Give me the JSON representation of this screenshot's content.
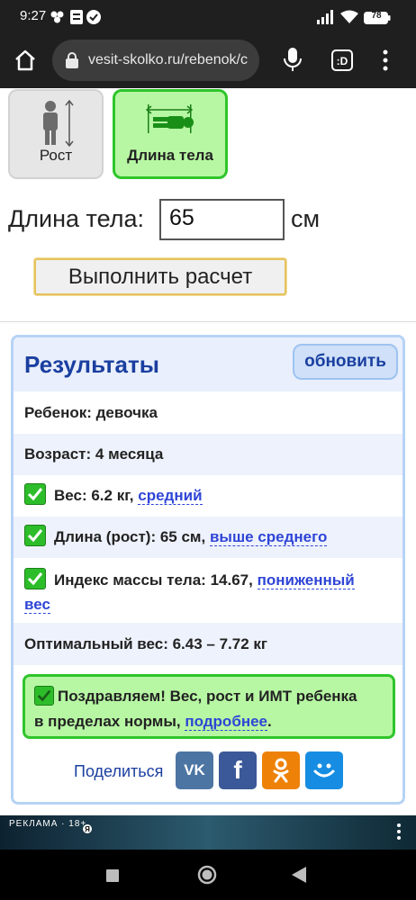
{
  "status_bar": {
    "time": "9:27",
    "battery": "78"
  },
  "browser": {
    "url": "vesit-skolko.ru/rebenok/c"
  },
  "tabs": [
    {
      "label": "Рост"
    },
    {
      "label": "Длина тела"
    }
  ],
  "form": {
    "length_label": "Длина тела:",
    "length_value": "65",
    "unit": "см",
    "submit_label": "Выполнить расчет"
  },
  "results": {
    "title": "Результаты",
    "refresh_label": "обновить",
    "child": "Ребенок: девочка",
    "age": "Возраст: 4 месяца",
    "weight_text": "Вес: 6.2 кг,",
    "weight_link": "средний",
    "length_text": "Длина (рост): 65 см,",
    "length_link": "выше среднего",
    "bmi_text": "Индекс массы тела: 14.67,",
    "bmi_link_1": "пониженный",
    "bmi_link_2": "вес",
    "optimal": "Оптимальный вес: 6.43 – 7.72 кг",
    "congrats_line1": "Поздравляем! Вес, рост и ИМТ ребенка",
    "congrats_line2": "в пределах нормы,",
    "congrats_link": "подробнее",
    "congrats_end": ".",
    "share_label": "Поделиться"
  },
  "ad": {
    "label": "РЕКЛАМА · 18+"
  },
  "colors": {
    "accent_green": "#2fc52b",
    "accent_blue": "#1a3fa0",
    "link": "#2f45d6",
    "vk": "#4c75a3",
    "facebook": "#3b5998",
    "ok": "#ee8208",
    "moimir": "#168de2"
  }
}
